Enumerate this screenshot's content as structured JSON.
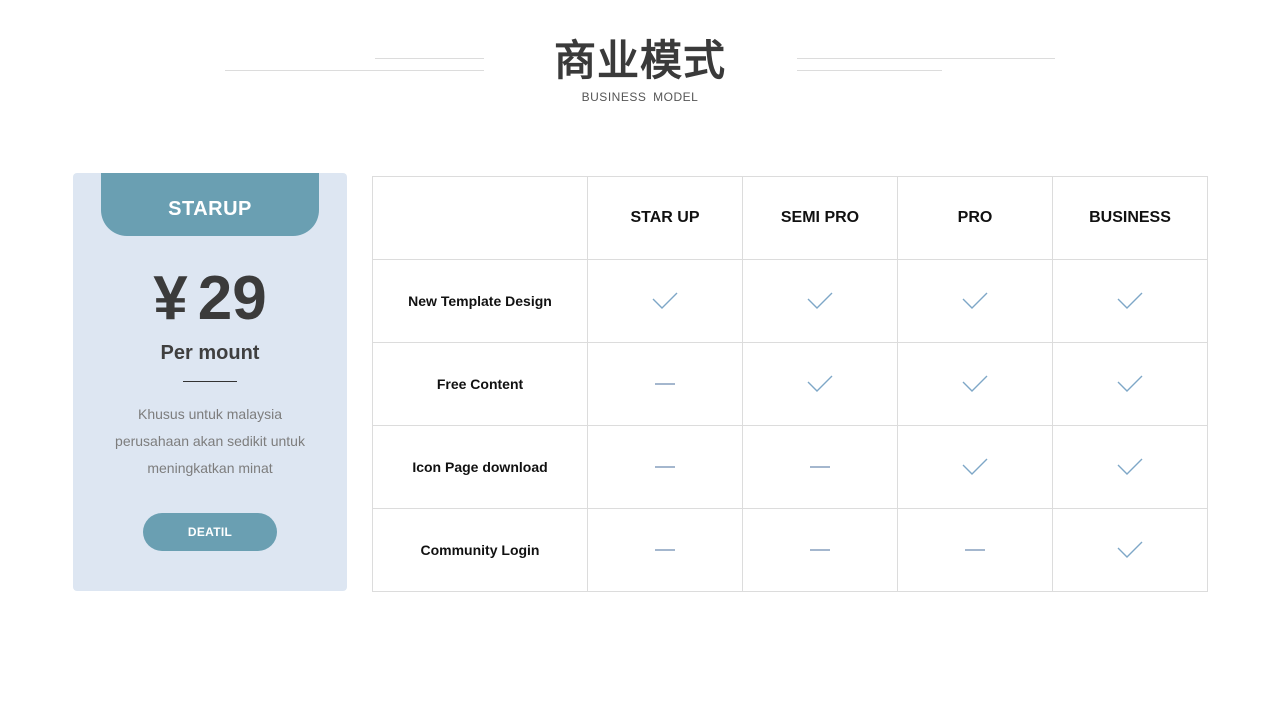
{
  "header": {
    "title": "商业模式",
    "subtitle": "BUSINESS MODEL"
  },
  "card": {
    "tab_label": "STARUP",
    "currency": "¥",
    "price": "29",
    "period": "Per mount",
    "description": "Khusus untuk malaysia perusahaan akan sedikit untuk meningkatkan minat",
    "button_label": "DEATIL"
  },
  "table": {
    "columns": [
      "STAR UP",
      "SEMI PRO",
      "PRO",
      "BUSINESS"
    ],
    "rows": [
      {
        "feature": "New Template Design",
        "values": [
          "check",
          "check",
          "check",
          "check"
        ]
      },
      {
        "feature": "Free Content",
        "values": [
          "dash",
          "check",
          "check",
          "check"
        ]
      },
      {
        "feature": "Icon Page download",
        "values": [
          "dash",
          "dash",
          "check",
          "check"
        ]
      },
      {
        "feature": "Community Login",
        "values": [
          "dash",
          "dash",
          "dash",
          "check"
        ]
      }
    ]
  },
  "colors": {
    "accent": "#6a9fb2",
    "card_bg": "#dde6f2",
    "check": "#7ea7c7",
    "dash": "#4a6f9e"
  }
}
